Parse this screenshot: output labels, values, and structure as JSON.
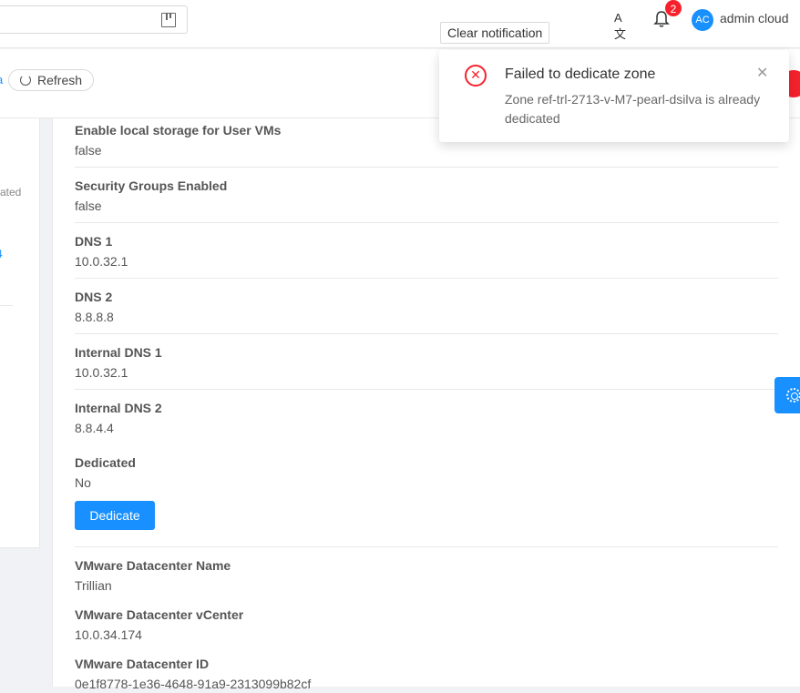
{
  "header": {
    "notification_count": "2",
    "avatar_initials": "AC",
    "username": "admin cloud",
    "clear_notification_label": "Clear notification"
  },
  "toolbar": {
    "refresh_label": "Refresh"
  },
  "left_card": {
    "link1": "l",
    "text": "ated",
    "link2": "4"
  },
  "details": [
    {
      "label": "Enable local storage for User VMs",
      "value": "false"
    },
    {
      "label": "Security Groups Enabled",
      "value": "false"
    },
    {
      "label": "DNS 1",
      "value": "10.0.32.1"
    },
    {
      "label": "DNS 2",
      "value": "8.8.8.8"
    },
    {
      "label": "Internal DNS 1",
      "value": "10.0.32.1"
    },
    {
      "label": "Internal DNS 2",
      "value": "8.8.4.4"
    },
    {
      "label": "Dedicated",
      "value": "No"
    },
    {
      "label": "VMware Datacenter Name",
      "value": "Trillian"
    },
    {
      "label": "VMware Datacenter vCenter",
      "value": "10.0.34.174"
    },
    {
      "label": "VMware Datacenter ID",
      "value": "0e1f8778-1e36-4648-91a9-2313099b82cf"
    }
  ],
  "dedicate_button_label": "Dedicate",
  "notification": {
    "title": "Failed to dedicate zone",
    "description": "Zone ref-trl-2713-v-M7-pearl-dsilva is already dedicated",
    "error_glyph": "✕",
    "close_glyph": "✕"
  },
  "icons": {
    "translate": "A文",
    "bell": "bell-icon",
    "gear": "gear-icon"
  },
  "colors": {
    "primary": "#1890ff",
    "error": "#f5222d"
  }
}
